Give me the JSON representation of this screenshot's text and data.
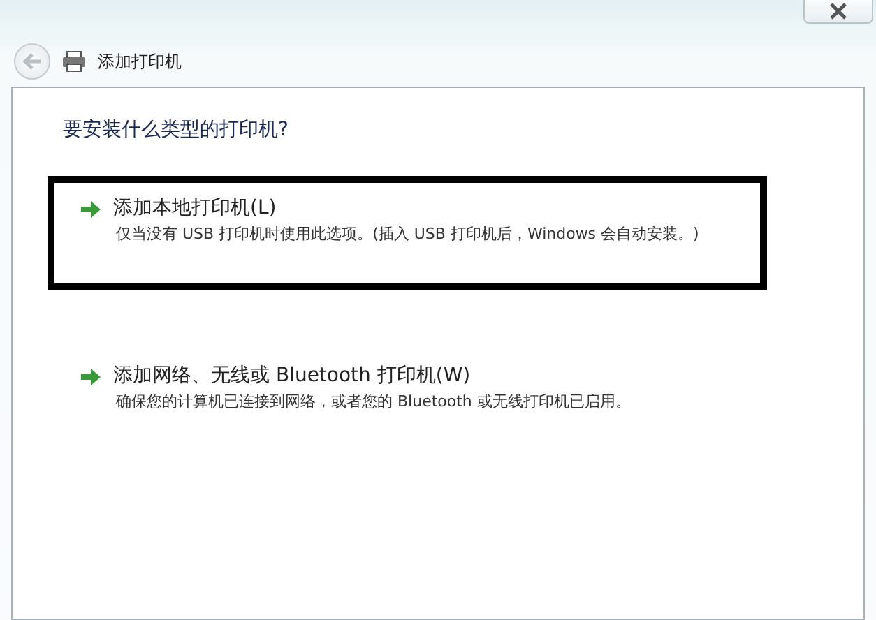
{
  "window": {
    "title": "添加打印机"
  },
  "question": "要安装什么类型的打印机?",
  "options": [
    {
      "title": "添加本地打印机(L)",
      "description": "仅当没有 USB 打印机时使用此选项。(插入 USB 打印机后，Windows 会自动安装。)",
      "highlighted": true
    },
    {
      "title": "添加网络、无线或 Bluetooth 打印机(W)",
      "description": "确保您的计算机已连接到网络，或者您的 Bluetooth 或无线打印机已启用。",
      "highlighted": false
    }
  ]
}
